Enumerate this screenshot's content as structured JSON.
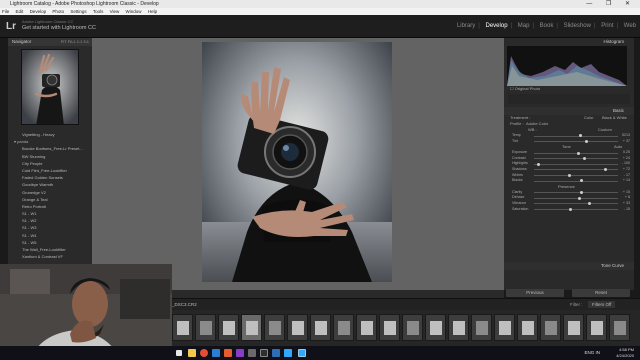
{
  "window": {
    "title": "Lightroom Catalog - Adobe Photoshop Lightroom Classic - Develop",
    "controls": "— ❐ ✕"
  },
  "menu": [
    "File",
    "Edit",
    "Develop",
    "Photo",
    "Settings",
    "Tools",
    "View",
    "Window",
    "Help"
  ],
  "identity": {
    "logo": "Lr",
    "small": "Adobe Lightroom Classic CC",
    "big": "Get started with Lightroom CC"
  },
  "modules": [
    {
      "label": "Library",
      "active": false
    },
    {
      "label": "Develop",
      "active": true
    },
    {
      "label": "Map",
      "active": false
    },
    {
      "label": "Book",
      "active": false
    },
    {
      "label": "Slideshow",
      "active": false
    },
    {
      "label": "Print",
      "active": false
    },
    {
      "label": "Web",
      "active": false
    }
  ],
  "navigator": {
    "title": "Navigator",
    "zoom": "FIT   FILL   1:1   3:1"
  },
  "presets": {
    "first": "Vignetting - Heavy",
    "group": "panda",
    "items": [
      "Brooke Bonfsms_Free-Lr Preset...",
      "BW Stunning",
      "City People",
      "Cold Fiint_Free-Lookfilter",
      "Faded Golden Sunsets",
      "Goodbye Warmth",
      "Grunedge V2",
      "Orange & Teal",
      "Retro Portrait",
      "S1 - W1",
      "S1 - W2",
      "S1 - W3",
      "S1 - W4",
      "S1 - W5",
      "The Wall_Free-Lookfilter",
      "Xantium & Contrast VF"
    ]
  },
  "histogram": {
    "title": "Histogram",
    "original_label": "Original Photo"
  },
  "basic": {
    "title": "Basic",
    "treatment_label": "Treatment :",
    "color": "Color",
    "bw": "Black & White",
    "profile_label": "Profile :",
    "profile_value": "Adobe Color",
    "wb_label": "WB :",
    "wb_value": "Custom",
    "tone_label": "Tone",
    "auto_label": "Auto",
    "presence_label": "Presence",
    "sliders": [
      {
        "label": "Temp",
        "value": "5213",
        "pos": 0.55
      },
      {
        "label": "Tint",
        "value": "+ 37",
        "pos": 0.62
      },
      {
        "label": "Exposure",
        "value": "0.25",
        "pos": 0.53
      },
      {
        "label": "Contrast",
        "value": "+ 24",
        "pos": 0.6
      },
      {
        "label": "Highlights",
        "value": "- 100",
        "pos": 0.05
      },
      {
        "label": "Shadows",
        "value": "+ 72",
        "pos": 0.85
      },
      {
        "label": "Whites",
        "value": "- 17",
        "pos": 0.42
      },
      {
        "label": "Blacks",
        "value": "+ 14",
        "pos": 0.57
      },
      {
        "label": "Clarity",
        "value": "+ 15",
        "pos": 0.57
      },
      {
        "label": "Dehaze",
        "value": "+ 8",
        "pos": 0.54
      },
      {
        "label": "Vibrance",
        "value": "+ 33",
        "pos": 0.66
      },
      {
        "label": "Saturation",
        "value": "- 15",
        "pos": 0.43
      }
    ]
  },
  "tone_curve": {
    "title": "Tone Curve"
  },
  "buttons": {
    "previous": "Previous",
    "reset": "Reset"
  },
  "filmstrip_bar": {
    "filename": "_DSC3.CR2",
    "filter_label": "Filter :",
    "filter_value": "Filters Off"
  },
  "filmstrip": {
    "count": 21,
    "selected": 3
  },
  "taskbar": {
    "lang": "ENG",
    "region": "IN",
    "time": "4:58 PM",
    "date": "4/24/2020"
  }
}
